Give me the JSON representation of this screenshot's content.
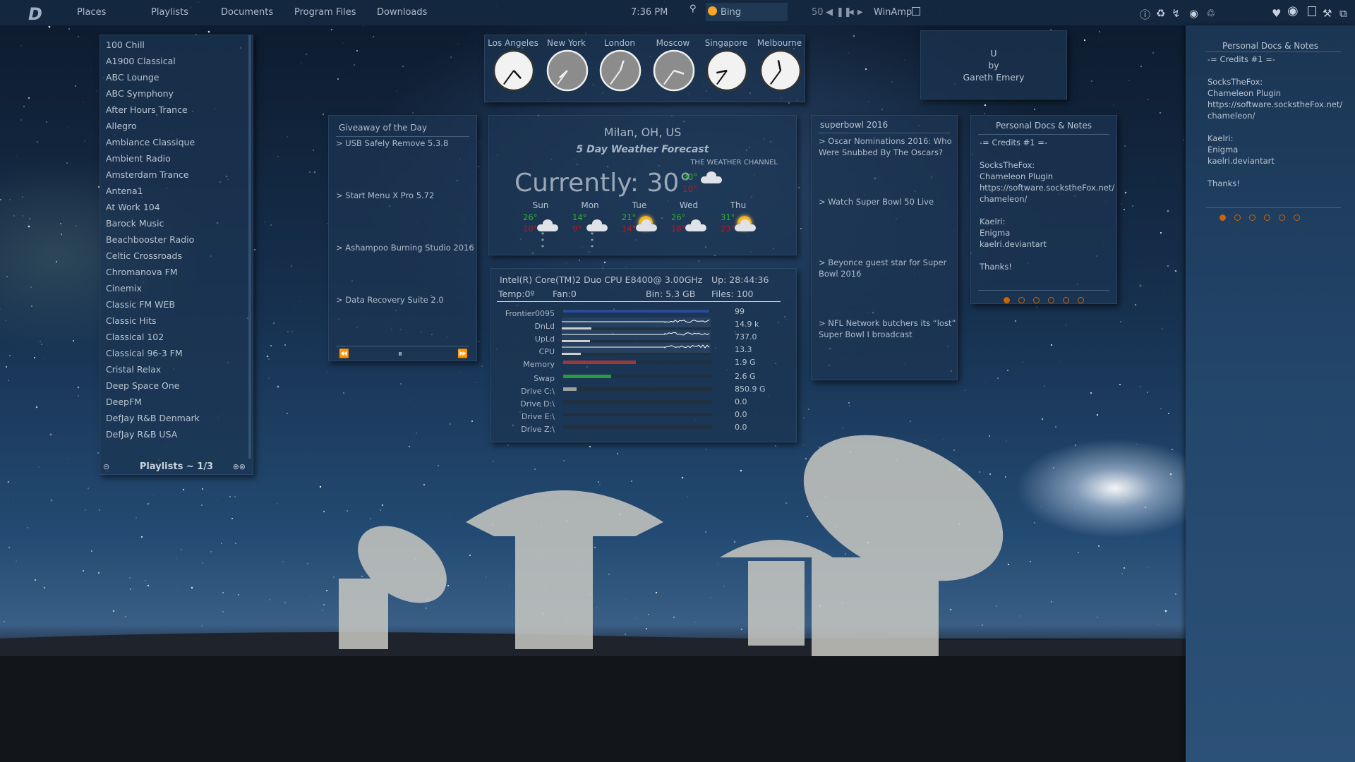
{
  "topbar": {
    "logo": "D",
    "menu": [
      "Places",
      "Playlists",
      "Documents",
      "Program Files",
      "Downloads"
    ],
    "time": "7:36 PM",
    "search_engine": "Bing",
    "volume": "50",
    "player": "WinAmp",
    "icons": [
      "location-pin-icon",
      "bing-icon",
      "prev-icon",
      "pause-icon",
      "back-icon",
      "forward-icon",
      "info-icon",
      "refresh-icon",
      "lightning-icon",
      "eye-icon",
      "recycle-bin-icon",
      "heart-icon",
      "record-icon",
      "window-icon",
      "tools-icon",
      "restore-icon"
    ]
  },
  "playlists": {
    "items": [
      "100 Chill",
      "A1900 Classical",
      "ABC Lounge",
      "ABC Symphony",
      "After Hours Trance",
      "Allegro",
      "Ambiance Classique",
      "Ambient Radio",
      "Amsterdam Trance",
      "Antena1",
      "At Work 104",
      "Barock Music",
      "Beachbooster Radio",
      "Celtic Crossroads",
      "Chromanova FM",
      "Cinemix",
      "Classic FM WEB",
      "Classic Hits",
      "Classical 102",
      "Classical 96-3 FM",
      "Cristal Relax",
      "Deep Space One",
      "DeepFM",
      "DefJay R&B Denmark",
      "DefJay R&B USA"
    ],
    "footer": "Playlists ~ 1/3"
  },
  "clocks": [
    {
      "city": "Los Angeles",
      "time": "16:36",
      "face": "white"
    },
    {
      "city": "New York",
      "time": "19:36",
      "face": "gray"
    },
    {
      "city": "London",
      "time": "00:36",
      "face": "gray"
    },
    {
      "city": "Moscow",
      "time": "03:36",
      "face": "gray"
    },
    {
      "city": "Singapore",
      "time": "08:36",
      "face": "white"
    },
    {
      "city": "Melbourne",
      "time": "11:36",
      "face": "white"
    }
  ],
  "now_playing": {
    "title": "U",
    "by": "by",
    "artist": "Gareth Emery"
  },
  "giveaway": {
    "title": "Giveaway of the Day",
    "items": [
      "> USB Safely Remove 5.3.8",
      "> Start Menu X Pro 5.72",
      "> Ashampoo Burning Studio 2016",
      "> Data Recovery Suite 2.0"
    ],
    "controls": [
      "⏪",
      "⏸",
      "⏩"
    ]
  },
  "weather": {
    "location": "Milan, OH, US",
    "subtitle": "5 Day Weather Forecast",
    "provider": "THE WEATHER CHANNEL",
    "current": "Currently: 30°",
    "high": "30°",
    "low": "10°",
    "current_icon": "cloudy",
    "days": [
      {
        "day": "Sun",
        "high": "26°",
        "low": "10°",
        "icon": "snow"
      },
      {
        "day": "Mon",
        "high": "14°",
        "low": "9°",
        "icon": "snow"
      },
      {
        "day": "Tue",
        "high": "21°",
        "low": "14°",
        "icon": "partly-sunny"
      },
      {
        "day": "Wed",
        "high": "26°",
        "low": "18°",
        "icon": "cloudy"
      },
      {
        "day": "Thu",
        "high": "31°",
        "low": "23°",
        "icon": "sunny"
      }
    ],
    "colors": {
      "high": "#2fb52f",
      "low": "#c0151a"
    }
  },
  "system": {
    "cpu": "Intel(R) Core(TM)2 Duo CPU E8400@ 3.00GHz",
    "uptime": "Up: 28:44:36",
    "temp": "Temp:0º",
    "fan": "Fan:0",
    "bin": "Bin: 5.3 GB",
    "files": "Files: 100",
    "rows": [
      {
        "label": "Frontier0095",
        "value": "99",
        "fill": 0.98,
        "color": "#2a4a9a",
        "graph": false
      },
      {
        "label": "DnLd",
        "value": "14.9 k",
        "fill": 0.2,
        "color": "#cfcfcf",
        "graph": true
      },
      {
        "label": "UpLd",
        "value": "737.0",
        "fill": 0.19,
        "color": "#cfcfcf",
        "graph": true
      },
      {
        "label": "CPU",
        "value": "13.3",
        "fill": 0.13,
        "color": "#cfcfcf",
        "graph": true
      },
      {
        "label": "Memory",
        "value": "1.9 G",
        "fill": 0.49,
        "color": "#9a3a3a",
        "graph": false
      },
      {
        "label": "Swap",
        "value": "2.6 G",
        "fill": 0.32,
        "color": "#2a9a3e",
        "graph": false
      },
      {
        "label": "Drive C:\\",
        "value": "850.9 G",
        "fill": 0.09,
        "color": "#a0a0a0",
        "graph": false
      },
      {
        "label": "Drive D:\\",
        "value": "0.0",
        "fill": 0,
        "color": "#a0a0a0",
        "graph": false
      },
      {
        "label": "Drive E:\\",
        "value": "0.0",
        "fill": 0,
        "color": "#a0a0a0",
        "graph": false
      },
      {
        "label": "Drive Z:\\",
        "value": "0.0",
        "fill": 0,
        "color": "#a0a0a0",
        "graph": false
      }
    ]
  },
  "news": {
    "title": "superbowl 2016",
    "items": [
      "> Oscar Nominations 2016: Who Were Snubbed By The Oscars?",
      "> Watch Super Bowl 50 Live",
      "> Beyonce guest star for Super Bowl 2016",
      "> NFL Network butchers its “lost” Super Bowl I broadcast"
    ]
  },
  "notes": {
    "title": "Personal Docs & Notes",
    "lines": [
      "-= Credits #1 =-",
      "",
      "SocksTheFox:",
      "Chameleon Plugin",
      "https://software.sockstheFox.net/",
      "chameleon/",
      "",
      "Kaelri:",
      "Enigma",
      "kaelri.deviantart",
      "",
      "Thanks!"
    ],
    "pages": 6,
    "active_page": 1,
    "accent": "#c9660c"
  }
}
